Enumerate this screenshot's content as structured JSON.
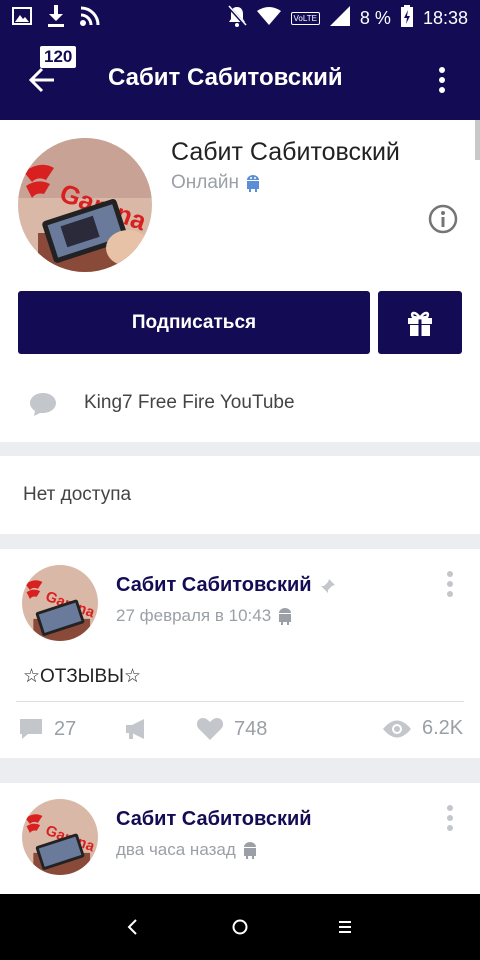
{
  "status_bar": {
    "battery_percent": "8 %",
    "time": "18:38",
    "volte": "VoLTE"
  },
  "header": {
    "title": "Сабит Сабитовский",
    "notification_count": "120"
  },
  "profile": {
    "name": "Сабит Сабитовский",
    "status": "Онлайн",
    "subscribe_label": "Подписаться",
    "status_text": "King7 Free Fire YouTube",
    "avatar_logo_text": "Garena"
  },
  "no_access": {
    "text": "Нет доступа"
  },
  "posts": [
    {
      "author": "Сабит Сабитовский",
      "time": "27 февраля в 10:43",
      "text": "☆ОТЗЫВЫ☆",
      "comments": "27",
      "likes": "748",
      "views": "6.2K"
    },
    {
      "author": "Сабит Сабитовский",
      "time": "два часа назад"
    }
  ],
  "colors": {
    "brand": "#130c55",
    "muted": "#9aa0a6",
    "android_icon": "#5b8ed6"
  }
}
